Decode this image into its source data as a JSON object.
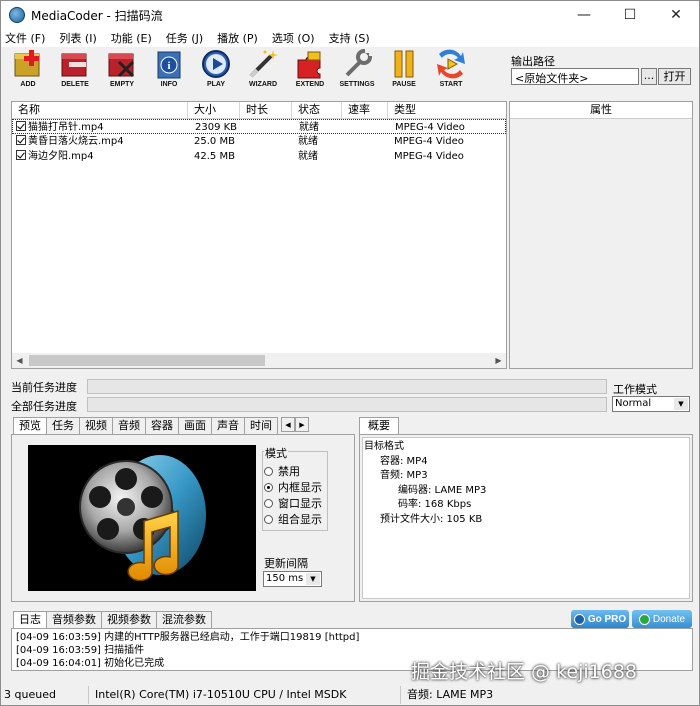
{
  "window": {
    "title": "MediaCoder - 扫描码流",
    "minimize": "—",
    "maximize": "☐",
    "close": "✕"
  },
  "menu": [
    "文件 (F)",
    "列表 (I)",
    "功能 (E)",
    "任务 (J)",
    "播放 (P)",
    "选项 (O)",
    "支持 (S)"
  ],
  "toolbar": [
    {
      "label": "ADD",
      "icon": "add-icon"
    },
    {
      "label": "DELETE",
      "icon": "delete-icon"
    },
    {
      "label": "EMPTY",
      "icon": "empty-icon"
    },
    {
      "label": "INFO",
      "icon": "info-icon"
    },
    {
      "label": "PLAY",
      "icon": "play-icon"
    },
    {
      "label": "WIZARD",
      "icon": "wizard-icon"
    },
    {
      "label": "EXTEND",
      "icon": "extend-icon"
    },
    {
      "label": "SETTINGS",
      "icon": "settings-icon"
    },
    {
      "label": "PAUSE",
      "icon": "pause-icon"
    },
    {
      "label": "START",
      "icon": "start-icon"
    }
  ],
  "output": {
    "label": "输出路径",
    "value": "<原始文件夹>",
    "browse": "...",
    "open": "打开"
  },
  "filelist": {
    "columns": [
      "名称",
      "大小",
      "时长",
      "状态",
      "速率",
      "类型"
    ],
    "rows": [
      {
        "name": "猫猫打吊针.mp4",
        "size": "2309 KB",
        "duration": "",
        "status": "就绪",
        "rate": "",
        "type": "MPEG-4 Video"
      },
      {
        "name": "黄昏日落火烧云.mp4",
        "size": "25.0 MB",
        "duration": "",
        "status": "就绪",
        "rate": "",
        "type": "MPEG-4 Video"
      },
      {
        "name": "海边夕阳.mp4",
        "size": "42.5 MB",
        "duration": "",
        "status": "就绪",
        "rate": "",
        "type": "MPEG-4 Video"
      }
    ]
  },
  "properties": {
    "header": "属性"
  },
  "progress": {
    "current_label": "当前任务进度",
    "total_label": "全部任务进度"
  },
  "work_mode": {
    "label": "工作模式",
    "value": "Normal"
  },
  "left_tabs": [
    "预览",
    "任务",
    "视频",
    "音频",
    "容器",
    "画面",
    "声音",
    "时间"
  ],
  "preview": {
    "mode_title": "模式",
    "modes": [
      "禁用",
      "内框显示",
      "窗口显示",
      "组合显示"
    ],
    "selected_mode": 1,
    "interval_label": "更新间隔",
    "interval_value": "150 ms"
  },
  "summary": {
    "tab": "概要",
    "tree": [
      {
        "level": 0,
        "text": "目标格式"
      },
      {
        "level": 1,
        "text": "容器: MP4"
      },
      {
        "level": 1,
        "text": "音频: MP3"
      },
      {
        "level": 2,
        "text": "编码器: LAME MP3"
      },
      {
        "level": 2,
        "text": "码率: 168 Kbps"
      },
      {
        "level": 1,
        "text": "预计文件大小: 105 KB"
      }
    ]
  },
  "bottom_tabs": [
    "日志",
    "音频参数",
    "视频参数",
    "混流参数"
  ],
  "badges": {
    "gopro": "Go PRO",
    "donate": "Donate"
  },
  "log": [
    "[04-09 16:03:59] 内建的HTTP服务器已经启动，工作于端口19819 [httpd]",
    "[04-09 16:03:59] 扫描插件",
    "[04-09 16:04:01] 初始化已完成"
  ],
  "status": {
    "queued": "3 queued",
    "cpu": "Intel(R) Core(TM) i7-10510U CPU  / Intel MSDK",
    "audio": "音频: LAME MP3"
  },
  "watermark": "掘金技术社区 @ keji1688"
}
